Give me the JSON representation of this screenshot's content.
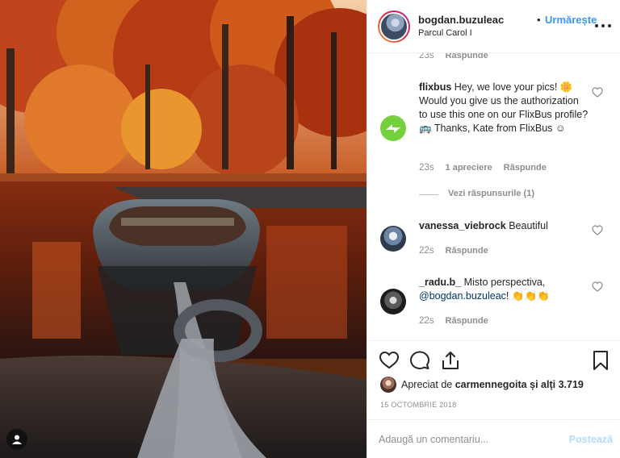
{
  "header": {
    "username": "bogdan.buzuleac",
    "separator": "•",
    "follow_label": "Urmărește",
    "location": "Parcul Carol I",
    "more_icon": "more-horizontal-icon"
  },
  "comments": [
    {
      "id": "partial",
      "time": "23s",
      "actions": [
        "Răspunde"
      ]
    },
    {
      "id": "flixbus",
      "username": "flixbus",
      "text_1": "Hey, we love your pics! ",
      "emoji_1": "🌼",
      "text_2": " Would you give us the authorization to use this one on our FlixBus profile? ",
      "emoji_2": "🚌",
      "text_3": " Thanks, Kate from FlixBus ",
      "emoji_3": "☺",
      "time": "23s",
      "likes": "1 apreciere",
      "reply": "Răspunde",
      "view_replies": "Vezi răspunsurile (1)"
    },
    {
      "id": "vanessa",
      "username": "vanessa_viebrock",
      "text": "Beautiful",
      "time": "22s",
      "reply": "Răspunde"
    },
    {
      "id": "radu",
      "username": "_radu.b_",
      "text": "Misto perspectiva,",
      "mention": "@bogdan.buzuleac",
      "text_after": "!",
      "emoji": "👏👏👏",
      "time": "22s",
      "reply": "Răspunde"
    }
  ],
  "actions": {
    "icons": [
      "heart-icon",
      "comment-icon",
      "share-icon",
      "bookmark-icon"
    ],
    "likes_prefix": "Apreciat de",
    "likes_user": "carmennegoita",
    "likes_suffix": "și alți",
    "likes_count": "3.719",
    "date": "15 OCTOMBRIE 2018"
  },
  "add_comment": {
    "placeholder": "Adaugă un comentariu...",
    "post_label": "Postează"
  },
  "photo": {
    "user_tag_icon": "user-tag-icon"
  },
  "colors": {
    "link": "#3897f0",
    "muted": "#8e8e8e",
    "text": "#262626",
    "post_disabled": "#b3dbff",
    "flixbus_green": "#73d13d"
  }
}
